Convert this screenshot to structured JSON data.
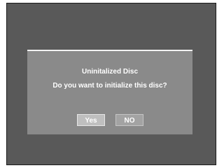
{
  "dialog": {
    "title": "Uninitalized Disc",
    "question": "Do you want to initialize this disc?",
    "buttons": {
      "yes_label": "Yes",
      "no_label": "NO"
    },
    "selected_button": "Yes"
  },
  "colors": {
    "screen_background": "#595959",
    "dialog_background": "#8a8a8a",
    "dialog_rule": "#f2f2f2",
    "selected_button": "#bfbfbf",
    "unselected_button": "#a3a3a3",
    "text": "#ffffff"
  }
}
